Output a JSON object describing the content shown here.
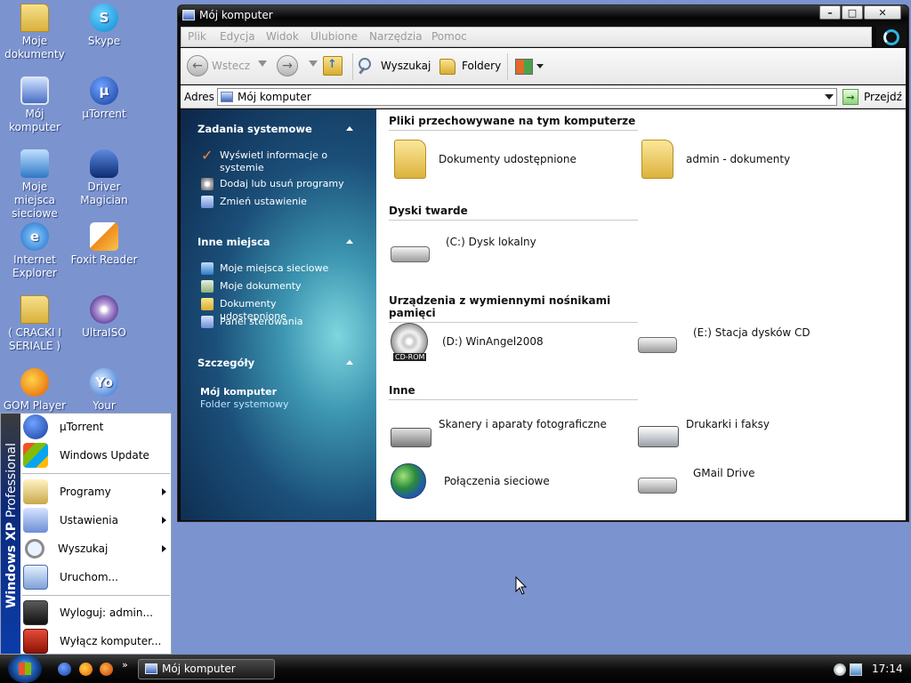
{
  "desktop": {
    "icons": [
      {
        "label": "Moje dokumenty",
        "icon": "my-documents-folder-icon"
      },
      {
        "label": "Skype",
        "icon": "skype-icon"
      },
      {
        "label": "Mój komputer",
        "icon": "my-computer-icon"
      },
      {
        "label": "µTorrent",
        "icon": "utorrent-icon"
      },
      {
        "label": "Moje miejsca sieciowe",
        "icon": "network-places-icon"
      },
      {
        "label": "Driver Magician",
        "icon": "driver-magician-icon"
      },
      {
        "label": "Internet Explorer",
        "icon": "internet-explorer-icon"
      },
      {
        "label": "Foxit Reader",
        "icon": "foxit-reader-icon"
      },
      {
        "label": "( CRACKI I SERIALE )",
        "icon": "folder-icon"
      },
      {
        "label": "UltraISO",
        "icon": "ultraiso-icon"
      },
      {
        "label": "GOM Player",
        "icon": "gom-player-icon"
      },
      {
        "label": "Your",
        "icon": "your-app-icon"
      }
    ]
  },
  "window": {
    "title": "Mój komputer",
    "controls": {
      "minimize": "minimize-icon",
      "maximize": "maximize-icon",
      "close": "close-icon"
    },
    "menu": [
      "Plik",
      "Edycja",
      "Widok",
      "Ulubione",
      "Narzędzia",
      "Pomoc"
    ],
    "toolbar": {
      "back": "Wstecz",
      "search": "Wyszukaj",
      "folders": "Foldery"
    },
    "address": {
      "label": "Adres",
      "value": "Mój komputer",
      "go": "Przejdź"
    },
    "tasks": {
      "system_title": "Zadania systemowe",
      "system_items": [
        "Wyświetl informacje o systemie",
        "Dodaj lub usuń programy",
        "Zmień ustawienie"
      ],
      "other_title": "Inne miejsca",
      "other_items": [
        "Moje miejsca sieciowe",
        "Moje dokumenty",
        "Dokumenty udostępnione",
        "Panel sterowania"
      ],
      "details_title": "Szczegóły",
      "details_name": "Mój komputer",
      "details_sub": "Folder systemowy"
    },
    "sections": {
      "stored": {
        "title": "Pliki przechowywane na tym komputerze",
        "items": [
          "Dokumenty udostępnione",
          "admin - dokumenty"
        ]
      },
      "hdd": {
        "title": "Dyski twarde",
        "items": [
          "(C:) Dysk lokalny"
        ]
      },
      "removable": {
        "title": "Urządzenia z wymiennymi nośnikami pamięci",
        "items": [
          "(D:) WinAngel2008",
          "(E:) Stacja dysków CD"
        ],
        "cd_badge": "CD-ROM"
      },
      "other": {
        "title": "Inne",
        "items": [
          "Skanery i aparaty fotograficzne",
          "Drukarki i faksy",
          "Połączenia sieciowe",
          "GMail Drive"
        ]
      }
    }
  },
  "start_menu": {
    "strip_brand": "Windows XP",
    "strip_edition": "Professional",
    "pinned": [
      "µTorrent",
      "Windows Update"
    ],
    "items": [
      "Programy",
      "Ustawienia",
      "Wyszukaj",
      "Uruchom..."
    ],
    "logoff": "Wyloguj: admin...",
    "shutdown": "Wyłącz komputer..."
  },
  "taskbar": {
    "task": "Mój komputer",
    "quicklaunch_more": "»",
    "clock": "17:14"
  },
  "colors": {
    "desktop": "#7b94cf",
    "taskbar": "#0c0c0c",
    "task_pane_dark": "#0c2649",
    "task_pane_light": "#7fd6df"
  }
}
